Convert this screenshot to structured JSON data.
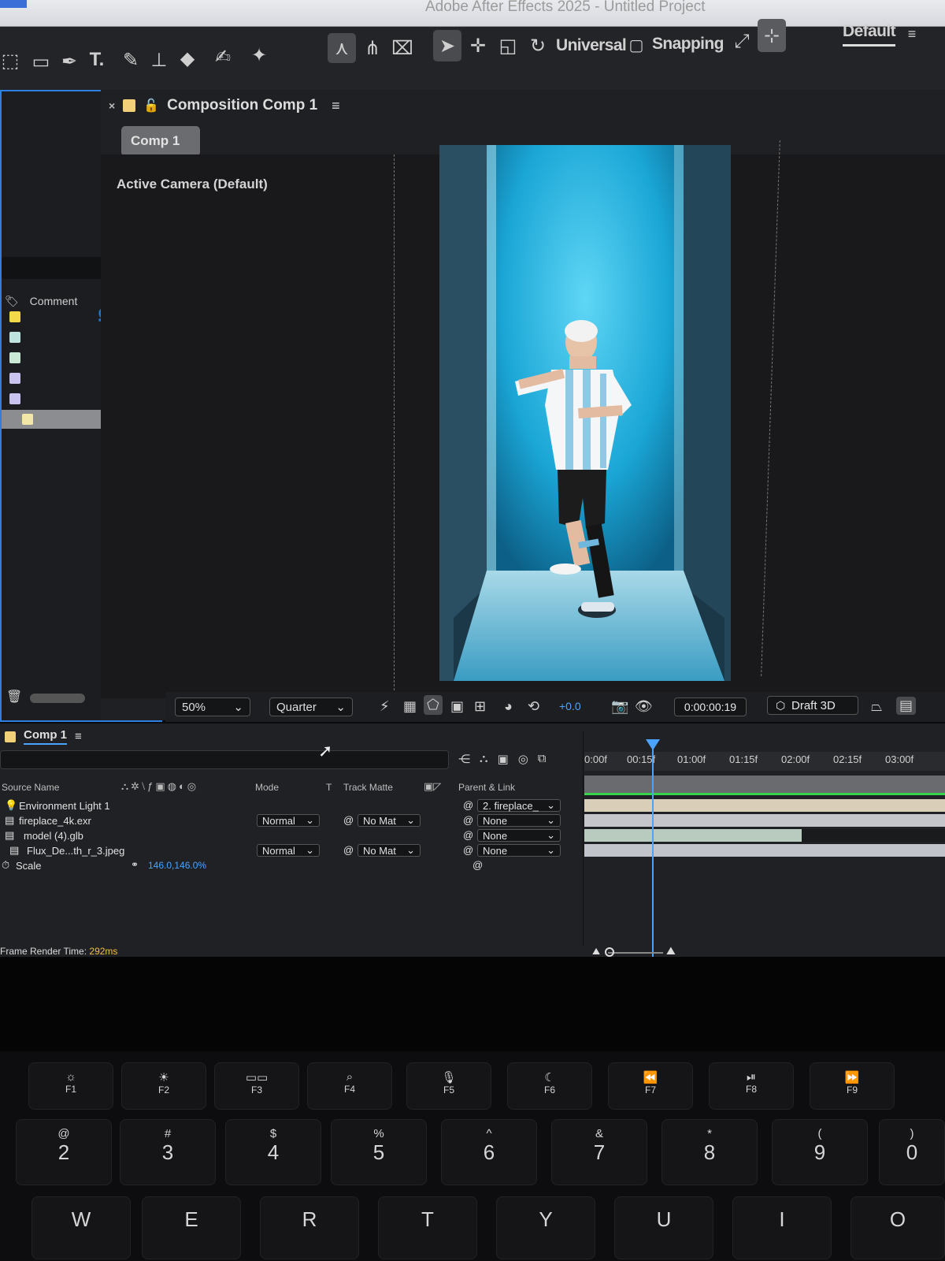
{
  "window": {
    "title": "Adobe After Effects 2025 - Untitled Project"
  },
  "toolbar": {
    "universal_label": "Universal",
    "snapping_label": "Snapping",
    "workspace_label": "Default"
  },
  "composition_panel": {
    "tab_label": "Composition Comp 1",
    "comp_button": "Comp 1",
    "camera_label": "Active Camera (Default)"
  },
  "project_panel": {
    "column_comment": "Comment",
    "label_colors": [
      "#f2d94a",
      "#bfe3df",
      "#c9e9d6",
      "#c9c3f0",
      "#c9c3f0",
      "#f0e7a8"
    ]
  },
  "viewer_bar": {
    "zoom": "50%",
    "resolution": "Quarter",
    "exposure": "+0.0",
    "timecode": "0:00:00:19",
    "renderer": "Draft 3D"
  },
  "timeline": {
    "tab_label": "Comp 1",
    "ruler_ticks": [
      "0:00f",
      "00:15f",
      "01:00f",
      "01:15f",
      "02:00f",
      "02:15f",
      "03:00f"
    ],
    "columns": {
      "source_name": "Source Name",
      "mode": "Mode",
      "t": "T",
      "track_matte": "Track Matte",
      "parent_link": "Parent & Link"
    },
    "layers": [
      {
        "name": "Environment Light 1",
        "mode": "",
        "matte": "",
        "parent": "2. fireplace_"
      },
      {
        "name": "fireplace_4k.exr",
        "mode": "Normal",
        "matte": "No Mat",
        "parent": "None"
      },
      {
        "name": "model (4).glb",
        "mode": "",
        "matte": "",
        "parent": "None"
      },
      {
        "name": "Flux_De...th_r_3.jpeg",
        "mode": "Normal",
        "matte": "No Mat",
        "parent": "None"
      }
    ],
    "property": {
      "name": "Scale",
      "value": "146.0,146.0%"
    },
    "frame_render_label": "Frame Render Time:",
    "frame_render_value": "292ms"
  },
  "keyboard": {
    "fn_keys": [
      "F1",
      "F2",
      "F3",
      "F4",
      "F5",
      "F6",
      "F7",
      "F8",
      "F9"
    ],
    "number_keys": [
      {
        "sym": "@",
        "num": "2"
      },
      {
        "sym": "#",
        "num": "3"
      },
      {
        "sym": "$",
        "num": "4"
      },
      {
        "sym": "%",
        "num": "5"
      },
      {
        "sym": "^",
        "num": "6"
      },
      {
        "sym": "&",
        "num": "7"
      },
      {
        "sym": "*",
        "num": "8"
      },
      {
        "sym": "(",
        "num": "9"
      },
      {
        "sym": ")",
        "num": "0"
      }
    ],
    "letter_keys": [
      "W",
      "E",
      "R",
      "T",
      "Y",
      "U",
      "I",
      "O"
    ]
  }
}
